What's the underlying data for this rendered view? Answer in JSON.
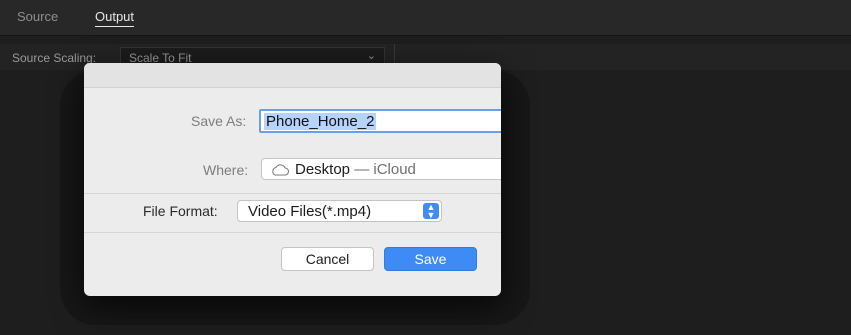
{
  "panel": {
    "tabs": [
      {
        "label": "Source",
        "active": false
      },
      {
        "label": "Output",
        "active": true
      }
    ],
    "source_scaling_label": "Source Scaling:",
    "source_scaling_value": "Scale To Fit"
  },
  "dialog": {
    "save_as_label": "Save As:",
    "save_as_value": "Phone_Home_2",
    "where_label": "Where:",
    "where_location": "Desktop",
    "where_suffix": "— iCloud",
    "file_format_label": "File Format:",
    "file_format_value": "Video Files(*.mp4)",
    "cancel_label": "Cancel",
    "save_label": "Save"
  },
  "colors": {
    "accent": "#3e8bf5",
    "selection": "#b5d3fc",
    "dialog_bg": "#ececec",
    "app_bg": "#1e1e1e"
  },
  "icons": {
    "where_icon": "cloud-icon",
    "stepper_icon": "up-down-chevron-icon",
    "expand_icon": "chevron-down-icon"
  }
}
